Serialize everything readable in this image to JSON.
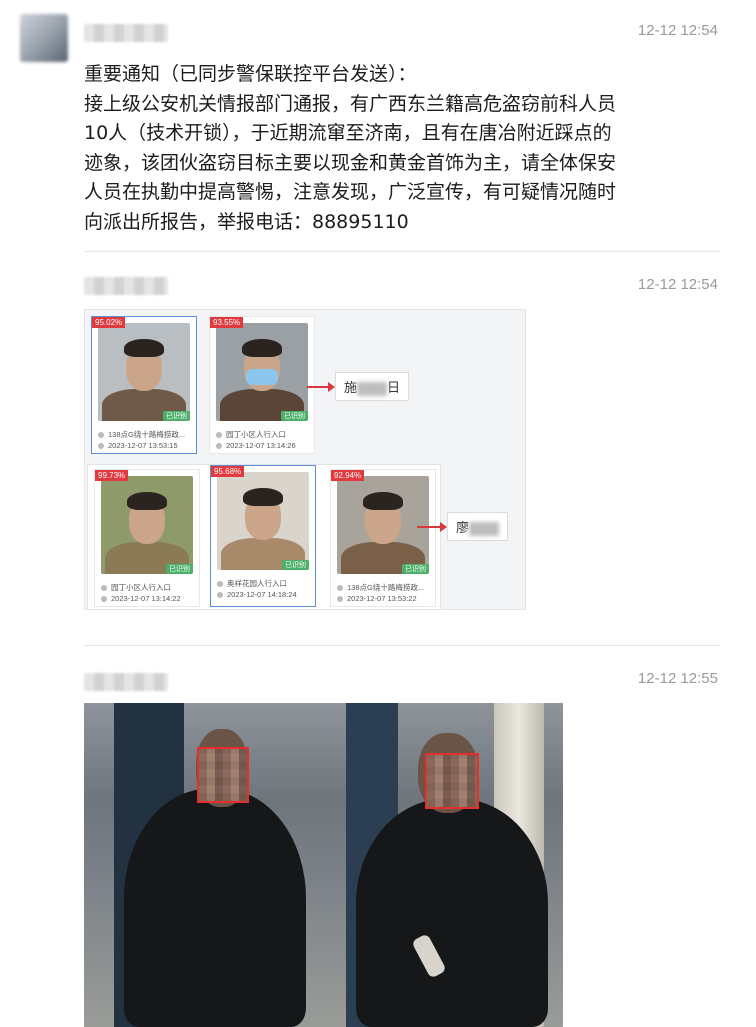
{
  "messages": [
    {
      "time": "12-12 12:54",
      "lines": [
        "重要通知（已同步警保联控平台发送）：",
        "接上级公安机关情报部门通报，有广西东兰籍高危盗窃前科人员",
        "10人（技术开锁），于近期流窜至济南，且有在唐冶附近踩点的",
        "迹象，该团伙盗窃目标主要以现金和黄金首饰为主，请全体保安",
        "人员在执勤中提高警惕，注意发现，广泛宣传，有可疑情况随时",
        "向派出所报告，举报电话：88895110"
      ]
    },
    {
      "time": "12-12 12:54",
      "cards_row1": [
        {
          "score": "95.02%",
          "tag": "已识别",
          "location": "138点G绕十路梅捞政...",
          "timestamp": "2023-12-07 13:53:15",
          "body_color": "#6f5a4a",
          "mask": false
        },
        {
          "score": "93.55%",
          "tag": "已识别",
          "location": "园丁小区人行入口",
          "timestamp": "2023-12-07 13:14:26",
          "body_color": "#5a4538",
          "mask": true
        }
      ],
      "cards_row2": [
        {
          "score": "99.73%",
          "tag": "已识别",
          "location": "园丁小区人行入口",
          "timestamp": "2023-12-07 13:14:22",
          "body_color": "#8a7a55",
          "mask": false
        },
        {
          "score": "95.68%",
          "tag": "已识别",
          "location": "奥祥花园人行入口",
          "timestamp": "2023-12-07 14:18:24",
          "body_color": "#a88a6a",
          "mask": false
        },
        {
          "score": "92.94%",
          "tag": "已识别",
          "location": "138点G绕十路梅捞政...",
          "timestamp": "2023-12-07 13:53:22",
          "body_color": "#7a6048",
          "mask": false
        }
      ],
      "name_label_1": "施",
      "name_label_1_suffix": "日",
      "name_label_2": "廖"
    },
    {
      "time": "12-12 12:55"
    }
  ]
}
